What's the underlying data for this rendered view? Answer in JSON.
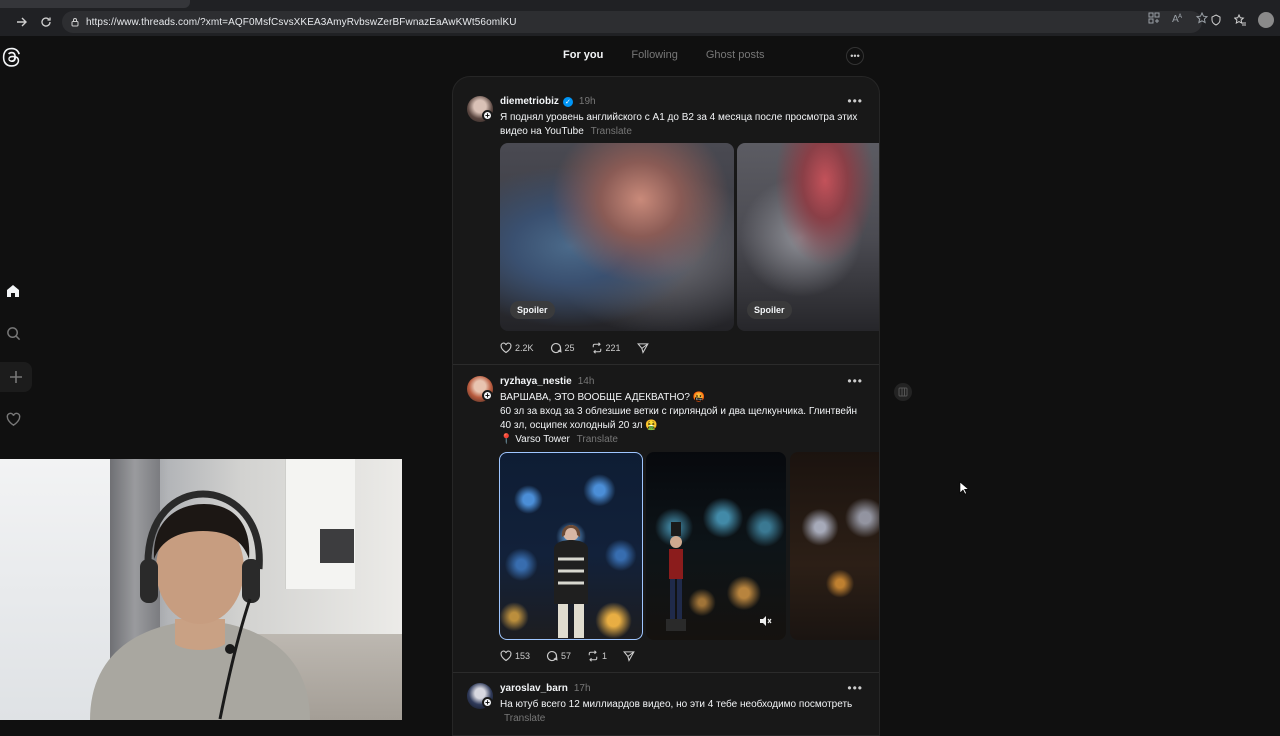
{
  "browser": {
    "url": "https://www.threads.com/?xmt=AQF0MsfCsvsXKEA3AmyRvbswZerBFwnazEaAwKWt56omlKU"
  },
  "feed_tabs": {
    "for_you": "For you",
    "following": "Following",
    "ghost_posts": "Ghost posts"
  },
  "posts": [
    {
      "username": "diemetriobiz",
      "verified": true,
      "time": "19h",
      "text": "Я поднял уровень английского с А1 до В2 за 4 месяца после просмотра этих видео на YouTube",
      "translate": "Translate",
      "media": [
        {
          "type": "spoiler-image",
          "label": "Spoiler"
        },
        {
          "type": "spoiler-image",
          "label": "Spoiler"
        }
      ],
      "likes": "2.2K",
      "comments": "25",
      "reposts": "221"
    },
    {
      "username": "ryzhaya_nestie",
      "verified": false,
      "time": "14h",
      "line1": "ВАРШАВА, ЭТО ВООБЩЕ АДЕКВАТНО? 🤬",
      "line2": "60 зл за вход за 3 облезшие ветки с гирляндой и два щелкунчика. Глинтвейн 40 зл, осципек холодный 20 зл 🤮",
      "location": "📍 Varso Tower",
      "translate": "Translate",
      "likes": "153",
      "comments": "57",
      "reposts": "1"
    },
    {
      "username": "yaroslav_barn",
      "verified": false,
      "time": "17h",
      "text": "На ютуб всего 12 миллиардов видео, но эти 4 тебе необходимо посмотреть",
      "translate": "Translate"
    }
  ],
  "colors": {
    "background": "#101010",
    "card": "#181818",
    "verified": "#0095f6",
    "muted_text": "#777777"
  }
}
